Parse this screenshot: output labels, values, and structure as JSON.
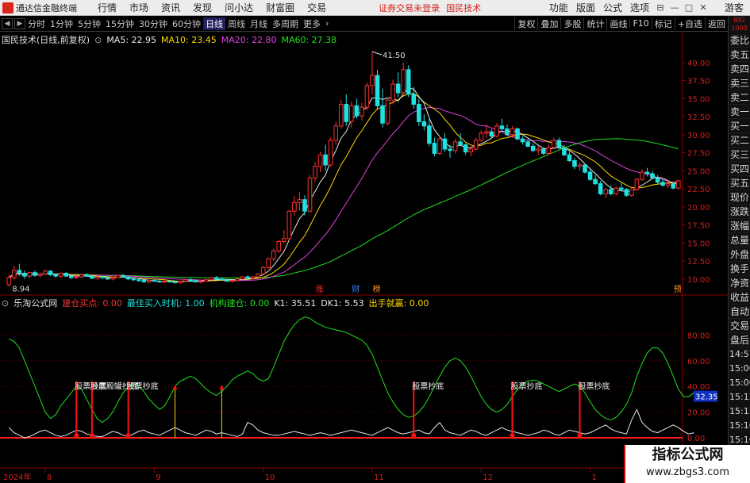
{
  "menubar": {
    "app_name": "通达信金融终端",
    "menus": [
      "行情",
      "市场",
      "资讯",
      "发现",
      "问小达",
      "财富圈",
      "交易"
    ],
    "status_text": "证券交易未登录",
    "stock_name": "国民技术",
    "right_menus": [
      "功能",
      "版面",
      "公式",
      "选项"
    ],
    "controls": [
      "⊟",
      "—",
      "□",
      "✕"
    ],
    "guest_label": "游客"
  },
  "toolbar": {
    "periods": [
      "分时",
      "1分钟",
      "5分钟",
      "15分钟",
      "30分钟",
      "60分钟",
      "日线",
      "周线",
      "月线",
      "多周期",
      "更多"
    ],
    "active_period": "日线",
    "right_buttons": [
      "复权",
      "叠加",
      "多股",
      "统计",
      "画线",
      "F10",
      "标记",
      "+自选",
      "返回"
    ]
  },
  "main_header": {
    "title": "国民技术(日线,前复权)",
    "ma": [
      {
        "label": "MA5: 22.95",
        "color": "#e8e8e8"
      },
      {
        "label": "MA10: 23.45",
        "color": "#ffd700"
      },
      {
        "label": "MA20: 22.80",
        "color": "#e040e0"
      },
      {
        "label": "MA60: 27.38",
        "color": "#20e020"
      }
    ]
  },
  "indicator_header": {
    "title": "乐淘公式网",
    "items": [
      {
        "label": "建仓买点: 0.00",
        "color": "#ff3030"
      },
      {
        "label": "最佳买入时机: 1.00",
        "color": "#20e0e0"
      },
      {
        "label": "机构建仓: 0.00",
        "color": "#20e020"
      },
      {
        "label": "K1: 35.51",
        "color": "#e8e8e8"
      },
      {
        "label": "DK1: 5.53",
        "color": "#e8e8e8"
      },
      {
        "label": "出手就赢: 0.00",
        "color": "#ffd700"
      }
    ]
  },
  "price_axis": {
    "ticks": [
      "40.00",
      "37.50",
      "35.00",
      "32.50",
      "30.00",
      "27.50",
      "25.00",
      "22.50",
      "20.00",
      "17.50",
      "15.00",
      "12.50",
      "10.00"
    ],
    "values": [
      40,
      37.5,
      35,
      32.5,
      30,
      27.5,
      25,
      22.5,
      20,
      17.5,
      15,
      12.5,
      10
    ]
  },
  "indicator_axis": {
    "ticks": [
      "80.00",
      "60.00",
      "40.00",
      "20.00",
      "0.00"
    ],
    "values": [
      80,
      60,
      40,
      20,
      0
    ],
    "current_value_label": "32.35",
    "current_value": 32.35
  },
  "annotations": {
    "high_label": "41.50",
    "high_value": 41.5,
    "low_label": "8.94",
    "low_value": 8.94,
    "event_marks": [
      {
        "label": "涨",
        "color": "#ff3030"
      },
      {
        "label": "财",
        "color": "#4080ff"
      },
      {
        "label": "榜",
        "color": "#ff9020"
      },
      {
        "label": "预",
        "color": "#ff9020"
      }
    ],
    "signal_label": "股票抄底",
    "signal_label_overlap": "股票殿罐抄底"
  },
  "time_axis": {
    "labels": [
      "2024年",
      "8",
      "9",
      "10",
      "11",
      "12",
      "1"
    ]
  },
  "sidepanel": {
    "top_label": "BIG\n1000",
    "items": [
      "委比",
      "卖五",
      "卖四",
      "卖三",
      "卖二",
      "卖一",
      "买一",
      "买二",
      "买三",
      "买四",
      "买五",
      "现价",
      "涨跌",
      "涨幅",
      "总量",
      "外盘",
      "换手",
      "净资",
      "收益"
    ],
    "section": [
      "自动",
      "交易",
      "盘后"
    ],
    "times": [
      "14:57",
      "15:00",
      "15:06",
      "15:12",
      "15:15",
      "15:16",
      "15:16"
    ]
  },
  "watermark": {
    "line1": "指标公式网",
    "line2": "www.zbgs3.com"
  },
  "colors": {
    "up": "#ff3030",
    "down": "#20e0e0",
    "ma5": "#e8e8e8",
    "ma10": "#ffd700",
    "ma20": "#e040e0",
    "ma60": "#20e020",
    "k_line": "#20e020",
    "dk_line": "#e8e8e8",
    "grid": "#8b0000"
  },
  "chart_data": {
    "type": "candlestick",
    "candles": [
      [
        9.2,
        10.6,
        8.94,
        10.2
      ],
      [
        10.2,
        11.8,
        9.9,
        11.2
      ],
      [
        11.2,
        12.1,
        10.4,
        10.8
      ],
      [
        10.8,
        11.2,
        10.0,
        10.4
      ],
      [
        10.4,
        11.0,
        10.1,
        10.9
      ],
      [
        10.9,
        11.2,
        10.3,
        10.5
      ],
      [
        10.5,
        10.9,
        10.2,
        10.7
      ],
      [
        10.7,
        11.3,
        10.5,
        11.1
      ],
      [
        11.1,
        11.2,
        10.4,
        10.6
      ],
      [
        10.6,
        10.8,
        10.2,
        10.4
      ],
      [
        10.4,
        10.9,
        10.2,
        10.8
      ],
      [
        10.8,
        11.0,
        10.3,
        10.4
      ],
      [
        10.4,
        10.6,
        10.0,
        10.2
      ],
      [
        10.2,
        10.5,
        10.0,
        10.3
      ],
      [
        10.3,
        10.7,
        10.1,
        10.6
      ],
      [
        10.6,
        10.8,
        10.3,
        10.4
      ],
      [
        10.4,
        10.5,
        10.0,
        10.1
      ],
      [
        10.1,
        10.4,
        9.9,
        10.3
      ],
      [
        10.3,
        10.5,
        10.0,
        10.2
      ],
      [
        10.2,
        10.3,
        9.9,
        10.0
      ],
      [
        10.0,
        10.3,
        9.8,
        10.2
      ],
      [
        10.2,
        10.6,
        10.1,
        10.5
      ],
      [
        10.5,
        10.7,
        10.2,
        10.3
      ],
      [
        10.3,
        10.4,
        9.9,
        10.0
      ],
      [
        10.0,
        10.2,
        9.7,
        9.9
      ],
      [
        9.9,
        10.1,
        9.6,
        9.8
      ],
      [
        9.8,
        10.0,
        9.5,
        9.6
      ],
      [
        9.6,
        9.9,
        9.4,
        9.8
      ],
      [
        9.8,
        10.0,
        9.6,
        9.7
      ],
      [
        9.7,
        9.9,
        9.5,
        9.6
      ],
      [
        9.6,
        9.8,
        9.4,
        9.7
      ],
      [
        9.7,
        9.9,
        9.5,
        9.6
      ],
      [
        9.6,
        9.8,
        9.4,
        9.5
      ],
      [
        9.5,
        9.8,
        9.3,
        9.7
      ],
      [
        9.7,
        10.0,
        9.6,
        9.9
      ],
      [
        9.9,
        10.1,
        9.7,
        9.8
      ],
      [
        9.8,
        9.9,
        9.5,
        9.6
      ],
      [
        9.6,
        9.8,
        9.4,
        9.7
      ],
      [
        9.7,
        10.0,
        9.6,
        9.9
      ],
      [
        9.9,
        10.3,
        9.8,
        10.2
      ],
      [
        10.2,
        10.4,
        9.9,
        10.0
      ],
      [
        10.0,
        10.2,
        9.8,
        9.9
      ],
      [
        9.9,
        10.0,
        9.6,
        9.7
      ],
      [
        9.7,
        9.9,
        9.5,
        9.8
      ],
      [
        9.8,
        10.1,
        9.7,
        10.0
      ],
      [
        10.0,
        10.4,
        9.9,
        10.3
      ],
      [
        10.3,
        10.5,
        10.0,
        10.1
      ],
      [
        10.1,
        10.4,
        10.0,
        10.3
      ],
      [
        10.3,
        10.8,
        10.2,
        10.7
      ],
      [
        10.7,
        11.8,
        10.6,
        11.6
      ],
      [
        11.6,
        13.0,
        11.4,
        12.8
      ],
      [
        12.8,
        14.2,
        12.5,
        13.9
      ],
      [
        13.9,
        15.4,
        13.6,
        15.2
      ],
      [
        15.2,
        16.8,
        14.9,
        15.6
      ],
      [
        15.6,
        19.6,
        15.3,
        19.4
      ],
      [
        19.4,
        21.5,
        18.8,
        20.6
      ],
      [
        20.6,
        22.1,
        19.5,
        21.0
      ],
      [
        21.0,
        21.6,
        18.8,
        19.4
      ],
      [
        19.4,
        24.4,
        19.2,
        24.0
      ],
      [
        24.0,
        26.2,
        23.4,
        25.6
      ],
      [
        25.6,
        27.6,
        24.8,
        27.2
      ],
      [
        27.2,
        28.6,
        25.0,
        25.8
      ],
      [
        25.8,
        29.6,
        25.6,
        29.2
      ],
      [
        29.2,
        31.8,
        28.6,
        31.2
      ],
      [
        31.2,
        34.8,
        30.8,
        34.2
      ],
      [
        34.2,
        35.6,
        31.2,
        31.8
      ],
      [
        31.8,
        34.6,
        31.0,
        34.0
      ],
      [
        34.0,
        35.0,
        32.2,
        32.6
      ],
      [
        32.6,
        34.4,
        32.0,
        33.8
      ],
      [
        33.8,
        37.2,
        33.4,
        36.8
      ],
      [
        36.8,
        41.5,
        35.6,
        38.2
      ],
      [
        38.2,
        39.0,
        33.4,
        34.0
      ],
      [
        34.0,
        36.4,
        31.0,
        31.6
      ],
      [
        31.6,
        35.2,
        31.2,
        34.8
      ],
      [
        34.8,
        37.6,
        34.2,
        37.0
      ],
      [
        37.0,
        38.6,
        35.2,
        35.8
      ],
      [
        35.8,
        40.0,
        35.4,
        39.0
      ],
      [
        39.0,
        39.6,
        35.2,
        35.6
      ],
      [
        35.6,
        36.6,
        33.6,
        34.2
      ],
      [
        34.2,
        35.0,
        31.2,
        31.8
      ],
      [
        31.8,
        32.8,
        30.6,
        31.2
      ],
      [
        31.2,
        32.4,
        28.4,
        28.8
      ],
      [
        28.8,
        29.6,
        27.0,
        27.4
      ],
      [
        27.4,
        29.8,
        27.2,
        29.4
      ],
      [
        29.4,
        30.2,
        27.6,
        28.0
      ],
      [
        28.0,
        28.6,
        26.8,
        27.8
      ],
      [
        27.8,
        29.4,
        27.4,
        29.0
      ],
      [
        29.0,
        30.2,
        28.4,
        28.6
      ],
      [
        28.6,
        28.8,
        27.2,
        27.6
      ],
      [
        27.6,
        28.4,
        27.0,
        28.0
      ],
      [
        28.0,
        29.6,
        27.8,
        29.2
      ],
      [
        29.2,
        30.6,
        29.0,
        30.2
      ],
      [
        30.2,
        31.4,
        29.6,
        30.4
      ],
      [
        30.4,
        30.8,
        29.4,
        29.8
      ],
      [
        29.8,
        31.6,
        29.6,
        31.2
      ],
      [
        31.2,
        32.2,
        30.4,
        30.8
      ],
      [
        30.8,
        31.4,
        29.8,
        30.0
      ],
      [
        30.0,
        31.2,
        29.6,
        30.8
      ],
      [
        30.8,
        31.0,
        29.2,
        29.4
      ],
      [
        29.4,
        29.8,
        28.6,
        29.0
      ],
      [
        29.0,
        29.4,
        28.2,
        28.4
      ],
      [
        28.4,
        28.8,
        27.6,
        27.8
      ],
      [
        27.8,
        28.4,
        27.2,
        28.0
      ],
      [
        28.0,
        28.2,
        27.2,
        27.4
      ],
      [
        27.4,
        28.6,
        27.2,
        28.2
      ],
      [
        28.2,
        29.6,
        28.0,
        29.2
      ],
      [
        29.2,
        29.6,
        28.0,
        28.2
      ],
      [
        28.2,
        28.6,
        27.0,
        27.2
      ],
      [
        27.2,
        27.8,
        26.2,
        26.4
      ],
      [
        26.4,
        26.8,
        25.2,
        25.6
      ],
      [
        25.6,
        26.2,
        25.0,
        25.8
      ],
      [
        25.8,
        26.0,
        24.6,
        24.8
      ],
      [
        24.8,
        25.2,
        23.6,
        23.8
      ],
      [
        23.8,
        24.4,
        23.0,
        23.2
      ],
      [
        23.2,
        23.6,
        21.6,
        21.8
      ],
      [
        21.8,
        22.6,
        21.2,
        22.4
      ],
      [
        22.4,
        23.0,
        21.6,
        21.8
      ],
      [
        21.8,
        22.8,
        21.6,
        22.6
      ],
      [
        22.6,
        23.4,
        22.2,
        22.4
      ],
      [
        22.4,
        22.6,
        21.4,
        21.6
      ],
      [
        21.6,
        22.6,
        21.4,
        22.4
      ],
      [
        22.4,
        24.0,
        22.2,
        23.8
      ],
      [
        23.8,
        25.2,
        23.6,
        24.8
      ],
      [
        24.8,
        25.4,
        24.2,
        24.6
      ],
      [
        24.6,
        25.0,
        23.8,
        24.0
      ],
      [
        24.0,
        24.4,
        23.2,
        23.4
      ],
      [
        23.4,
        23.8,
        22.8,
        23.0
      ],
      [
        23.0,
        23.6,
        22.6,
        23.2
      ],
      [
        23.2,
        23.4,
        22.4,
        22.6
      ],
      [
        22.6,
        23.8,
        22.4,
        23.6
      ]
    ],
    "k_series": [
      77,
      75,
      70,
      60,
      50,
      40,
      30,
      20,
      15,
      18,
      25,
      30,
      35,
      40,
      38,
      30,
      22,
      15,
      12,
      15,
      20,
      28,
      35,
      40,
      42,
      40,
      36,
      30,
      26,
      22,
      25,
      32,
      40,
      44,
      46,
      48,
      46,
      42,
      38,
      35,
      33,
      36,
      40,
      45,
      48,
      50,
      52,
      50,
      46,
      44,
      46,
      55,
      65,
      75,
      82,
      88,
      92,
      94,
      93,
      90,
      88,
      86,
      85,
      84,
      83,
      82,
      80,
      78,
      76,
      72,
      65,
      55,
      45,
      35,
      28,
      22,
      18,
      16,
      17,
      20,
      25,
      32,
      40,
      48,
      55,
      60,
      62,
      60,
      55,
      48,
      40,
      32,
      26,
      22,
      20,
      22,
      26,
      32,
      38,
      42,
      44,
      45,
      44,
      42,
      40,
      38,
      36,
      38,
      40,
      42,
      40,
      35,
      28,
      22,
      18,
      15,
      14,
      16,
      20,
      26,
      35,
      48,
      58,
      66,
      70,
      70,
      66,
      58,
      48,
      38,
      32,
      32,
      35
    ],
    "dk_series": [
      8,
      4,
      2,
      0,
      1,
      3,
      5,
      6,
      4,
      2,
      1,
      2,
      4,
      6,
      5,
      3,
      2,
      1,
      1,
      3,
      5,
      4,
      2,
      1,
      3,
      5,
      6,
      4,
      3,
      2,
      4,
      6,
      8,
      6,
      4,
      3,
      2,
      4,
      6,
      5,
      3,
      4,
      3,
      2,
      1,
      3,
      12,
      10,
      6,
      4,
      3,
      2,
      2,
      3,
      4,
      5,
      4,
      3,
      2,
      3,
      4,
      3,
      2,
      3,
      4,
      5,
      6,
      5,
      4,
      3,
      2,
      4,
      6,
      8,
      6,
      4,
      3,
      4,
      5,
      6,
      4,
      3,
      8,
      12,
      6,
      4,
      3,
      2,
      4,
      6,
      5,
      3,
      2,
      4,
      6,
      8,
      6,
      5,
      4,
      3,
      2,
      3,
      4,
      6,
      5,
      3,
      2,
      4,
      6,
      5,
      4,
      3,
      4,
      6,
      8,
      10,
      7,
      5,
      4,
      3,
      14,
      22,
      12,
      8,
      5,
      4,
      6,
      8,
      10,
      8,
      5,
      3,
      4
    ]
  }
}
